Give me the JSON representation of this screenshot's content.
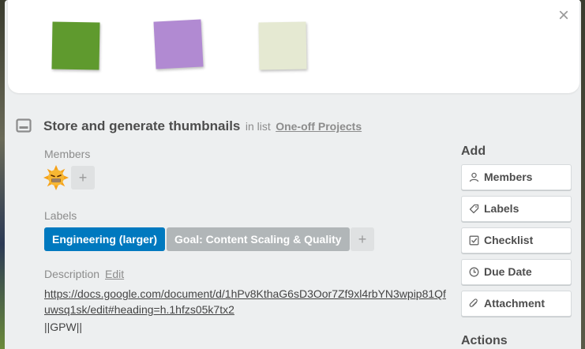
{
  "close_glyph": "×",
  "card": {
    "title": "Store and generate thumbnails",
    "in_list_prefix": "in list",
    "list_name": "One-off Projects"
  },
  "members": {
    "label": "Members",
    "add_glyph": "+"
  },
  "labels": {
    "label": "Labels",
    "items": [
      {
        "text": "Engineering (larger)",
        "color": "#0079bf"
      },
      {
        "text": "Goal: Content Scaling & Quality",
        "color": "#b1b6b8"
      }
    ],
    "add_glyph": "+"
  },
  "description": {
    "label": "Description",
    "edit_label": "Edit",
    "link": "https://docs.google.com/document/d/1hPv8KthaG6sD3Oor7Zf9xl4rbYN3wpip81Qfuwsq1sk/edit#heading=h.1hfzs05k7tx2",
    "text": "||GPW||"
  },
  "sidebar": {
    "add_heading": "Add",
    "buttons": [
      {
        "label": "Members",
        "icon": "person-icon"
      },
      {
        "label": "Labels",
        "icon": "tag-icon"
      },
      {
        "label": "Checklist",
        "icon": "checkbox-icon"
      },
      {
        "label": "Due Date",
        "icon": "clock-icon"
      },
      {
        "label": "Attachment",
        "icon": "paperclip-icon"
      }
    ],
    "actions_heading": "Actions"
  },
  "colors": {
    "sticky_green": "#5f9a2e",
    "sticky_purple": "#b18ad2",
    "sticky_cream": "#e5e9d2"
  }
}
